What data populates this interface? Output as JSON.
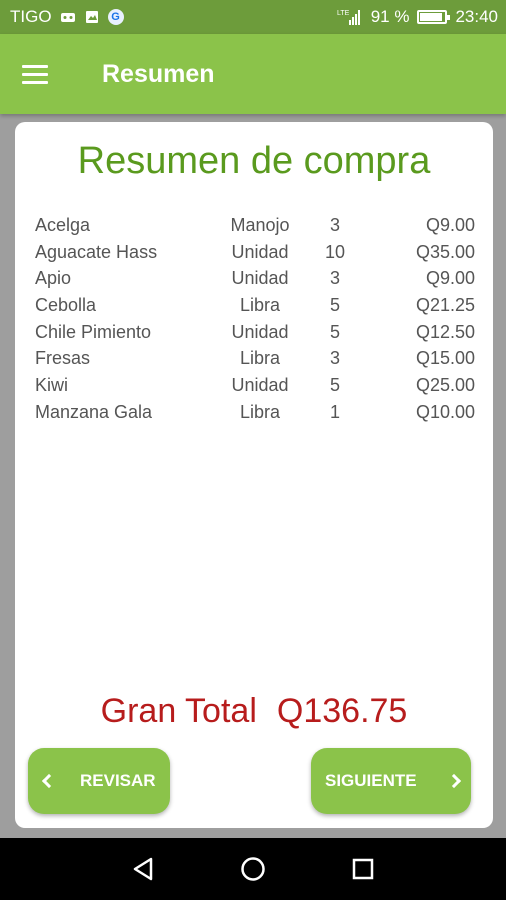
{
  "status_bar": {
    "carrier": "TIGO",
    "network_label": "LTE",
    "battery_text": "91 %",
    "battery_level": 0.91,
    "time": "23:40"
  },
  "app_bar": {
    "title": "Resumen",
    "menu_icon": "hamburger-menu-icon"
  },
  "summary": {
    "heading": "Resumen de compra",
    "items": [
      {
        "name": "Acelga",
        "unit": "Manojo",
        "qty": "3",
        "price": "Q9.00"
      },
      {
        "name": "Aguacate Hass",
        "unit": "Unidad",
        "qty": "10",
        "price": "Q35.00"
      },
      {
        "name": "Apio",
        "unit": "Unidad",
        "qty": "3",
        "price": "Q9.00"
      },
      {
        "name": "Cebolla",
        "unit": "Libra",
        "qty": "5",
        "price": "Q21.25"
      },
      {
        "name": "Chile Pimiento",
        "unit": "Unidad",
        "qty": "5",
        "price": "Q12.50"
      },
      {
        "name": "Fresas",
        "unit": "Libra",
        "qty": "3",
        "price": "Q15.00"
      },
      {
        "name": "Kiwi",
        "unit": "Unidad",
        "qty": "5",
        "price": "Q25.00"
      },
      {
        "name": "Manzana Gala",
        "unit": "Libra",
        "qty": "1",
        "price": "Q10.00"
      }
    ],
    "total_label": "Gran Total",
    "total_value": "Q136.75"
  },
  "buttons": {
    "back_label": "REVISAR",
    "next_label": "SIGUIENTE"
  },
  "colors": {
    "app_bar": "#8bc34a",
    "status_bar": "#6d9c3b",
    "heading": "#5a9a1e",
    "total": "#b71c1c"
  }
}
